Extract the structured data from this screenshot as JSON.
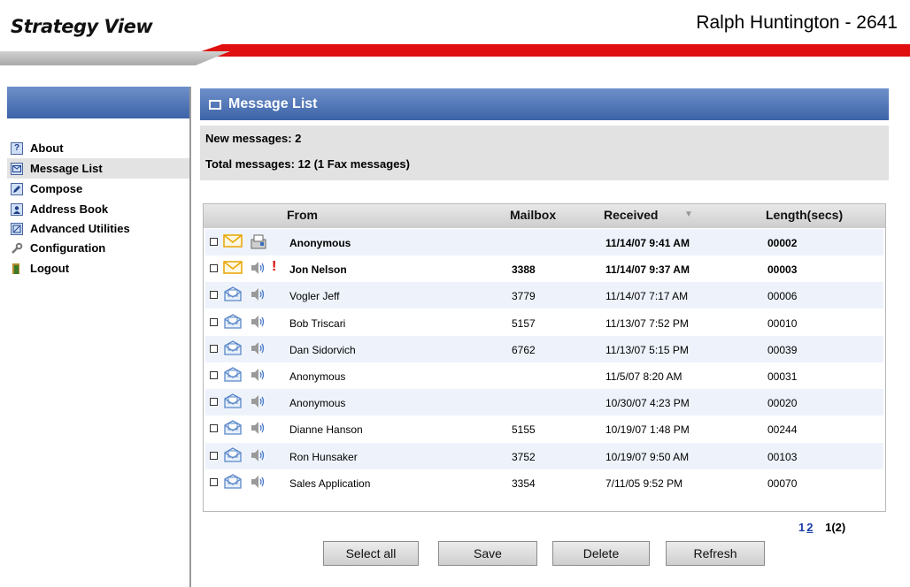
{
  "header": {
    "logo_text": "Strategy View",
    "user_title": "Ralph Huntington - 2641"
  },
  "sidebar": {
    "items": [
      {
        "label": "About",
        "icon": "help-icon"
      },
      {
        "label": "Message List",
        "icon": "mail-list-icon",
        "active": true
      },
      {
        "label": "Compose",
        "icon": "compose-icon"
      },
      {
        "label": "Address Book",
        "icon": "address-book-icon"
      },
      {
        "label": "Advanced Utilities",
        "icon": "utilities-icon"
      },
      {
        "label": "Configuration",
        "icon": "wrench-icon"
      },
      {
        "label": "Logout",
        "icon": "logout-icon"
      }
    ]
  },
  "panel": {
    "title": "Message List",
    "new_messages": "New messages: 2",
    "total_messages": "Total messages: 12  (1  Fax messages)"
  },
  "table": {
    "headers": {
      "from": "From",
      "mailbox": "Mailbox",
      "received": "Received",
      "length": "Length(secs)"
    },
    "rows": [
      {
        "from": "Anonymous",
        "mailbox": "",
        "received": "11/14/07 9:41 AM",
        "length": "00002",
        "unread": true,
        "fax": true,
        "urgent": false
      },
      {
        "from": "Jon Nelson",
        "mailbox": "3388",
        "received": "11/14/07 9:37 AM",
        "length": "00003",
        "unread": true,
        "fax": false,
        "urgent": true
      },
      {
        "from": "Vogler Jeff",
        "mailbox": "3779",
        "received": "11/14/07 7:17 AM",
        "length": "00006",
        "unread": false,
        "fax": false,
        "urgent": false
      },
      {
        "from": "Bob Triscari",
        "mailbox": "5157",
        "received": "11/13/07 7:52 PM",
        "length": "00010",
        "unread": false,
        "fax": false,
        "urgent": false
      },
      {
        "from": "Dan Sidorvich",
        "mailbox": "6762",
        "received": "11/13/07 5:15 PM",
        "length": "00039",
        "unread": false,
        "fax": false,
        "urgent": false
      },
      {
        "from": "Anonymous",
        "mailbox": "",
        "received": "11/5/07 8:20 AM",
        "length": "00031",
        "unread": false,
        "fax": false,
        "urgent": false
      },
      {
        "from": "Anonymous",
        "mailbox": "",
        "received": "10/30/07 4:23 PM",
        "length": "00020",
        "unread": false,
        "fax": false,
        "urgent": false
      },
      {
        "from": "Dianne Hanson",
        "mailbox": "5155",
        "received": "10/19/07 1:48 PM",
        "length": "00244",
        "unread": false,
        "fax": false,
        "urgent": false
      },
      {
        "from": "Ron Hunsaker",
        "mailbox": "3752",
        "received": "10/19/07 9:50 AM",
        "length": "00103",
        "unread": false,
        "fax": false,
        "urgent": false
      },
      {
        "from": "Sales Application",
        "mailbox": "3354",
        "received": "7/11/05 9:52 PM",
        "length": "00070",
        "unread": false,
        "fax": false,
        "urgent": false
      }
    ]
  },
  "pager": {
    "page1": "1",
    "page2": "2",
    "current": "1(2)"
  },
  "buttons": {
    "select_all": "Select all",
    "save": "Save",
    "delete": "Delete",
    "refresh": "Refresh"
  },
  "colors": {
    "accent_blue": "#3d63a8",
    "brand_red": "#e01010",
    "unread_env": "#e9a400",
    "read_env": "#5a87c8"
  }
}
